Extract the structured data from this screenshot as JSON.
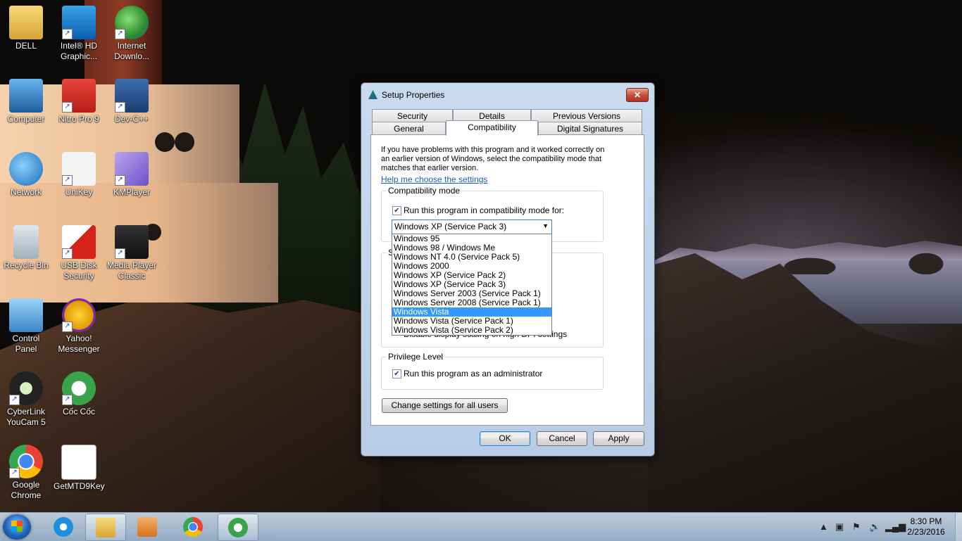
{
  "desktop": {
    "icons": [
      {
        "label": "DELL",
        "icon": "folder-user-icon"
      },
      {
        "label": "Intel® HD Graphic...",
        "icon": "intel-graphics-icon"
      },
      {
        "label": "Internet Downlo...",
        "icon": "internet-download-manager-icon"
      },
      {
        "label": "Computer",
        "icon": "computer-icon"
      },
      {
        "label": "Nitro Pro 9",
        "icon": "nitro-pro-icon"
      },
      {
        "label": "Dev-C++",
        "icon": "dev-cpp-icon"
      },
      {
        "label": "Network",
        "icon": "network-icon"
      },
      {
        "label": "UniKey",
        "icon": "unikey-icon"
      },
      {
        "label": "KMPlayer",
        "icon": "kmplayer-icon"
      },
      {
        "label": "Recycle Bin",
        "icon": "recycle-bin-icon"
      },
      {
        "label": "USB Disk Security",
        "icon": "usb-disk-security-icon"
      },
      {
        "label": "Media Player Classic",
        "icon": "media-player-classic-icon"
      },
      {
        "label": "Control Panel",
        "icon": "control-panel-icon"
      },
      {
        "label": "Yahoo! Messenger",
        "icon": "yahoo-messenger-icon"
      },
      {
        "label": "CyberLink YouCam 5",
        "icon": "youcam-icon"
      },
      {
        "label": "Cốc Cốc",
        "icon": "coccoc-icon"
      },
      {
        "label": "Google Chrome",
        "icon": "chrome-icon"
      },
      {
        "label": "GetMTD9Key",
        "icon": "getmtd9key-icon"
      }
    ]
  },
  "dialog": {
    "title": "Setup Properties",
    "close": "✕",
    "tabs": {
      "security": "Security",
      "details": "Details",
      "previous_versions": "Previous Versions",
      "general": "General",
      "compatibility": "Compatibility",
      "digital_signatures": "Digital Signatures"
    },
    "intro": "If you have problems with this program and it worked correctly on an earlier version of Windows, select the compatibility mode that matches that earlier version.",
    "help_link": "Help me choose the settings",
    "compat_group": {
      "label": "Compatibility mode",
      "checkbox_label": "Run this program in compatibility mode for:",
      "checked": true,
      "selected_value": "Windows XP (Service Pack 3)"
    },
    "dropdown_options": [
      "Windows 95",
      "Windows 98 / Windows Me",
      "Windows NT 4.0 (Service Pack 5)",
      "Windows 2000",
      "Windows XP (Service Pack 2)",
      "Windows XP (Service Pack 3)",
      "Windows Server 2003 (Service Pack 1)",
      "Windows Server 2008 (Service Pack 1)",
      "Windows Vista",
      "Windows Vista (Service Pack 1)",
      "Windows Vista (Service Pack 2)"
    ],
    "highlighted_option": "Windows Vista",
    "settings_group": {
      "label_partial": "S",
      "hidden_checkbox_partial": "Disable display scaling on high DPI settings"
    },
    "privilege_group": {
      "label": "Privilege Level",
      "checkbox_label": "Run this program as an administrator",
      "checked": true
    },
    "change_all_button": "Change settings for all users",
    "buttons": {
      "ok": "OK",
      "cancel": "Cancel",
      "apply": "Apply"
    }
  },
  "taskbar": {
    "items": [
      {
        "name": "internet-explorer",
        "icon": "ie-icon"
      },
      {
        "name": "windows-explorer",
        "icon": "folder-icon"
      },
      {
        "name": "media-player",
        "icon": "media-player-icon"
      },
      {
        "name": "google-chrome",
        "icon": "chrome-icon"
      },
      {
        "name": "coccoc",
        "icon": "coccoc-icon"
      }
    ],
    "clock": {
      "time": "8:30 PM",
      "date": "2/23/2016"
    }
  },
  "colors": {
    "selection": "#3399ff",
    "link": "#1a5fb4",
    "close_button": "#c7503b"
  }
}
